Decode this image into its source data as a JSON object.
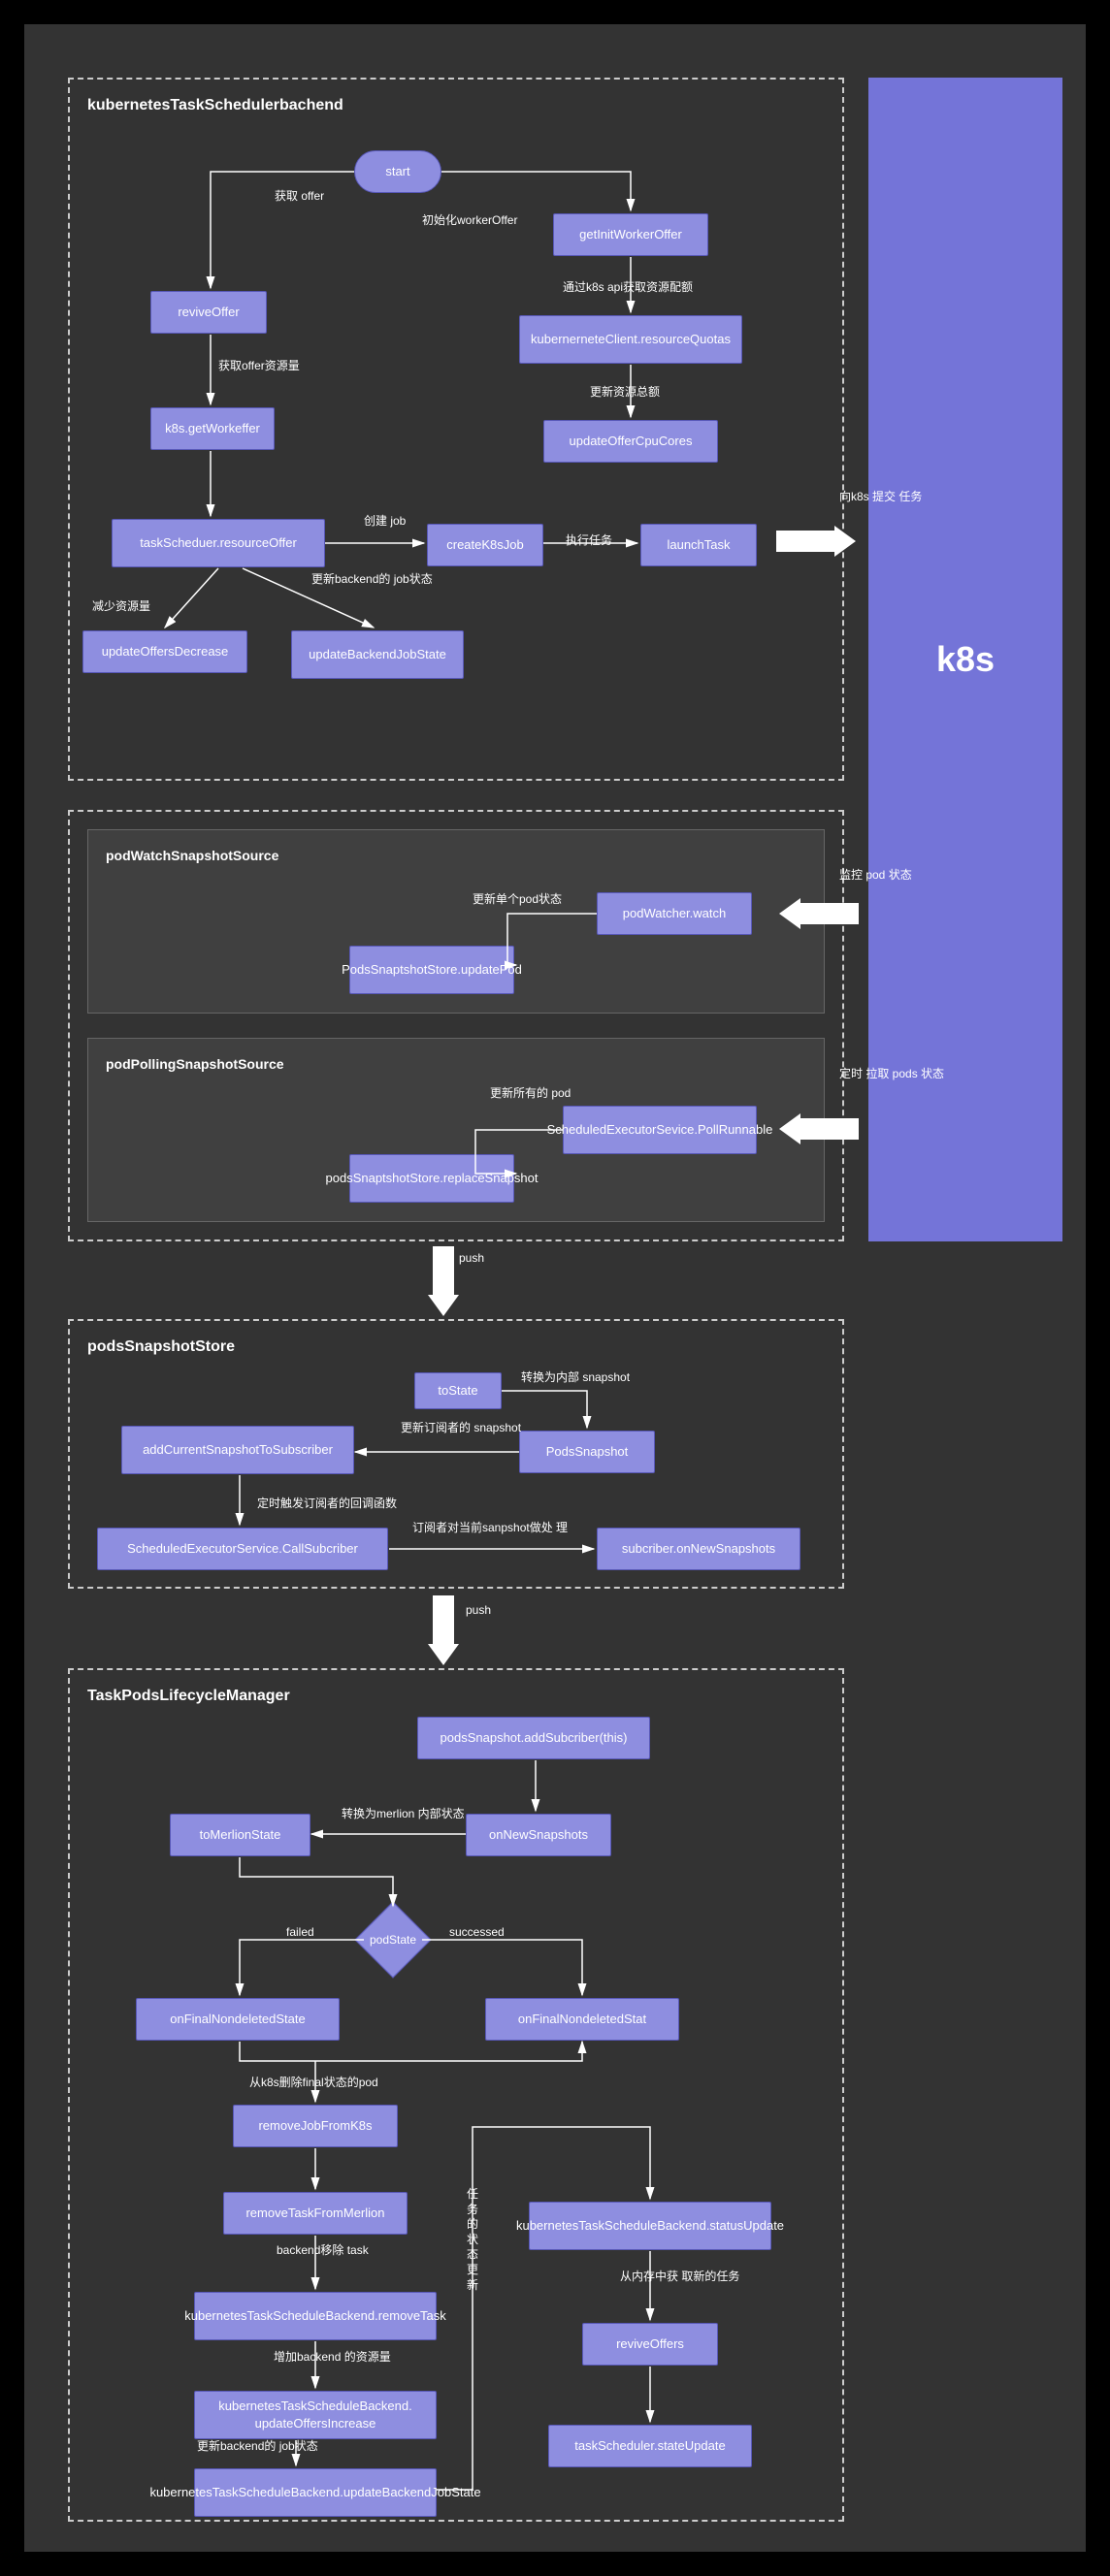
{
  "k8s": "k8s",
  "groups": {
    "g1": "kubernetesTaskSchedulerbachend",
    "g2a": "podWatchSnapshotSource",
    "g2b": "podPollingSnapshotSource",
    "g3": "podsSnapshotStore",
    "g4": "TaskPodsLifecycleManager"
  },
  "nodes": {
    "start": "start",
    "getInitWorkerOffer": "getInitWorkerOffer",
    "reviveOffer": "reviveOffer",
    "resourceQuotas": "kubernerneteClient.resourceQuotas",
    "getWorkeffer": "k8s.getWorkeffer",
    "updateOfferCpuCores": "updateOfferCpuCores",
    "resourceOffer": "taskScheduer.resourceOffer",
    "createK8sJob": "createK8sJob",
    "launchTask": "launchTask",
    "updateOffersDecrease": "updateOffersDecrease",
    "updateBackendJobState": "updateBackendJobState",
    "podWatcherWatch": "podWatcher.watch",
    "updatePod": "PodsSnaptshotStore.updatePod",
    "scheduledPoll": "ScheduledExecutorSevice.PollRunnable",
    "replaceSnapshot": "podsSnaptshotStore.replaceSnapshot",
    "toState": "toState",
    "podsSnapshot": "PodsSnapshot",
    "addCurrentSnapshot": "addCurrentSnapshotToSubscriber",
    "callSubscriber": "ScheduledExecutorService.CallSubcriber",
    "subcriberOnNew": "subcriber.onNewSnapshots",
    "addSubscriber": "podsSnapshot.addSubcriber(this)",
    "onNewSnapshots": "onNewSnapshots",
    "toMerlionState": "toMerlionState",
    "podState": "podState",
    "onFinalNondeletedState": "onFinalNondeletedState",
    "onFinalNondeletedStat": "onFinalNondeletedStat",
    "removeJobFromK8s": "removeJobFromK8s",
    "removeTaskFromMerlion": "removeTaskFromMerlion",
    "removeTask": "kubernetesTaskScheduleBackend.removeTask",
    "updateOffersIncrease": "kubernetesTaskScheduleBackend. updateOffersIncrease",
    "updateBackendJobState2": "kubernetesTaskScheduleBackend.updateBackendJobState",
    "statusUpdate": "kubernetesTaskScheduleBackend.statusUpdate",
    "reviveOffers": "reviveOffers",
    "stateUpdate": "taskScheduler.stateUpdate"
  },
  "labels": {
    "l1": "获取\noffer",
    "l2": "初始化workerOffer",
    "l3": "通过k8s api获取资源配额",
    "l4": "获取offer资源量",
    "l5": "更新资源总额",
    "l6": "创建\njob",
    "l7": "执行任务",
    "l8": "减少资源量",
    "l9": "更新backend的\njob状态",
    "l10": "向k8s\n提交\n任务",
    "l11": "监控\npod\n状态",
    "l12": "定时\n拉取\npods\n状态",
    "l13": "更新单个pod状态",
    "l14": "更新所有的\npod",
    "l15": "push",
    "l16": "转换为内部\nsnapshot",
    "l17": "更新订阅者的\nsnapshot",
    "l18": "定时触发订阅者的回调函数",
    "l19": "订阅者对当前sanpshot做处\n理",
    "l20": "push",
    "l21": "转换为merlion\n内部状态",
    "l22": "failed",
    "l23": "successed",
    "l24": "从k8s删除final状态的pod",
    "l25": "backend移除\ntask",
    "l26": "增加backend\n的资源量",
    "l27": "更新backend的\njob状态",
    "l28": "任\n务\n的\n状\n态\n更\n新",
    "l29": "从内存中获\n取新的任务"
  }
}
